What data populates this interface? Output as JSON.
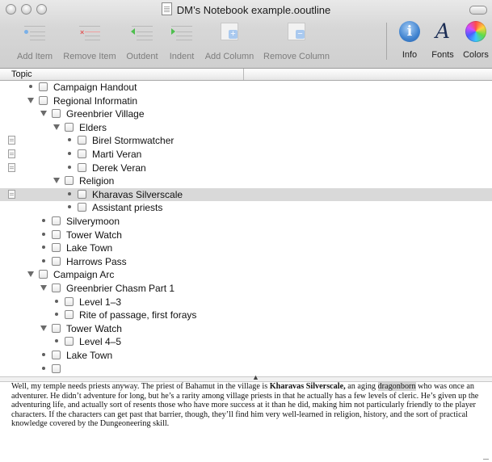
{
  "window": {
    "title": "DM’s Notebook example.ooutline"
  },
  "toolbar": {
    "buttons": [
      {
        "label": "Add Item",
        "icon": "add-item-icon"
      },
      {
        "label": "Remove Item",
        "icon": "remove-item-icon"
      },
      {
        "label": "Outdent",
        "icon": "outdent-icon"
      },
      {
        "label": "Indent",
        "icon": "indent-icon"
      },
      {
        "label": "Add Column",
        "icon": "add-column-icon"
      },
      {
        "label": "Remove Column",
        "icon": "remove-column-icon"
      }
    ],
    "info_label": "Info",
    "fonts_label": "Fonts",
    "colors_label": "Colors",
    "fonts_glyph": "A",
    "info_glyph": "i"
  },
  "header": {
    "topic_label": "Topic"
  },
  "outline": {
    "rows": [
      {
        "label": "Campaign Handout",
        "depth": 0,
        "expanded": null,
        "has_note": false,
        "selected": false
      },
      {
        "label": "Regional Informatin",
        "depth": 0,
        "expanded": true,
        "has_note": false,
        "selected": false
      },
      {
        "label": "Greenbrier Village",
        "depth": 1,
        "expanded": true,
        "has_note": false,
        "selected": false
      },
      {
        "label": "Elders",
        "depth": 2,
        "expanded": true,
        "has_note": false,
        "selected": false
      },
      {
        "label": "Birel Stormwatcher",
        "depth": 3,
        "expanded": null,
        "has_note": true,
        "selected": false
      },
      {
        "label": "Marti Veran",
        "depth": 3,
        "expanded": null,
        "has_note": true,
        "selected": false
      },
      {
        "label": "Derek Veran",
        "depth": 3,
        "expanded": null,
        "has_note": true,
        "selected": false
      },
      {
        "label": "Religion",
        "depth": 2,
        "expanded": true,
        "has_note": false,
        "selected": false
      },
      {
        "label": "Kharavas Silverscale",
        "depth": 3,
        "expanded": null,
        "has_note": true,
        "selected": true
      },
      {
        "label": "Assistant priests",
        "depth": 3,
        "expanded": null,
        "has_note": false,
        "selected": false
      },
      {
        "label": "Silverymoon",
        "depth": 1,
        "expanded": null,
        "has_note": false,
        "selected": false
      },
      {
        "label": "Tower Watch",
        "depth": 1,
        "expanded": null,
        "has_note": false,
        "selected": false
      },
      {
        "label": "Lake Town",
        "depth": 1,
        "expanded": null,
        "has_note": false,
        "selected": false
      },
      {
        "label": "Harrows Pass",
        "depth": 1,
        "expanded": null,
        "has_note": false,
        "selected": false
      },
      {
        "label": "Campaign Arc",
        "depth": 0,
        "expanded": true,
        "has_note": false,
        "selected": false
      },
      {
        "label": "Greenbrier Chasm Part 1",
        "depth": 1,
        "expanded": true,
        "has_note": false,
        "selected": false
      },
      {
        "label": "Level 1–3",
        "depth": 2,
        "expanded": null,
        "has_note": false,
        "selected": false
      },
      {
        "label": "Rite of passage, first forays",
        "depth": 2,
        "expanded": null,
        "has_note": false,
        "selected": false
      },
      {
        "label": "Tower Watch",
        "depth": 1,
        "expanded": true,
        "has_note": false,
        "selected": false
      },
      {
        "label": "Level 4–5",
        "depth": 2,
        "expanded": null,
        "has_note": false,
        "selected": false
      },
      {
        "label": "Lake Town",
        "depth": 1,
        "expanded": null,
        "has_note": false,
        "selected": false
      },
      {
        "label": "",
        "depth": 1,
        "expanded": null,
        "has_note": false,
        "selected": false
      }
    ]
  },
  "note": {
    "text_1": "Well, my temple needs priests anyway. The priest of Bahamut in the village is ",
    "bold_name": "Kharavas Silverscale,",
    "text_2": " an aging ",
    "highlight": "dragonborn",
    "text_3": " who was once an adventurer. He didn’t adventure for long, but he’s a rarity among village priests in that he actually has a few levels of cleric. He’s given up the adventuring life, and actually sort of resents those who have more success at it than he did, making him not particularly friendly to the player characters. If the characters can get past that barrier, though, they’ll find him very well-learned in religion, history, and the sort of practical knowledge covered by the Dungeoneering skill."
  }
}
